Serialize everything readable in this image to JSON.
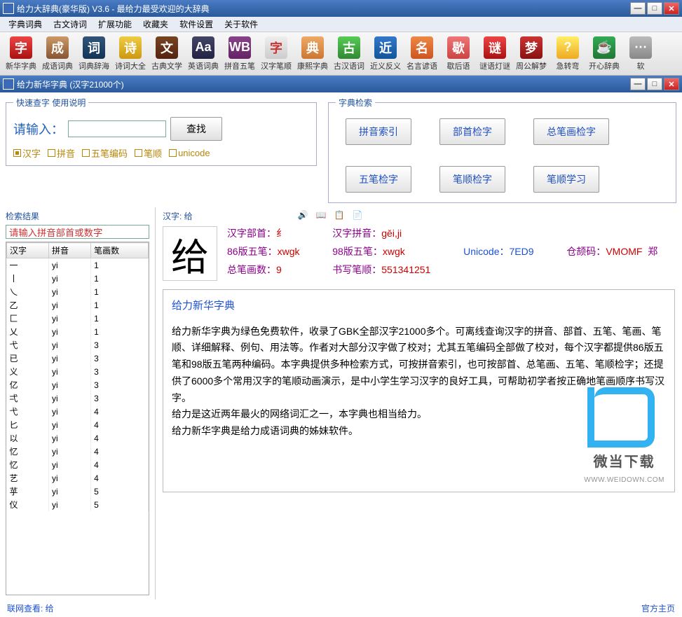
{
  "main_title": "给力大辞典(豪华版) V3.6  -  最给力最受欢迎的大辞典",
  "menus": [
    "字典词典",
    "古文诗词",
    "扩展功能",
    "收藏夹",
    "软件设置",
    "关于软件"
  ],
  "toolbar": [
    {
      "label": "新华字典",
      "glyph": "字"
    },
    {
      "label": "成语词典",
      "glyph": "成"
    },
    {
      "label": "词典辞海",
      "glyph": "词"
    },
    {
      "label": "诗词大全",
      "glyph": "诗"
    },
    {
      "label": "古典文学",
      "glyph": "文"
    },
    {
      "label": "英语词典",
      "glyph": "Aa"
    },
    {
      "label": "拼音五笔",
      "glyph": "WB"
    },
    {
      "label": "汉字笔顺",
      "glyph": "字"
    },
    {
      "label": "康熙字典",
      "glyph": "典"
    },
    {
      "label": "古汉语词",
      "glyph": "古"
    },
    {
      "label": "近义反义",
      "glyph": "近"
    },
    {
      "label": "名言谚语",
      "glyph": "名"
    },
    {
      "label": "歇后语",
      "glyph": "歇"
    },
    {
      "label": "谜语灯谜",
      "glyph": "谜"
    },
    {
      "label": "周公解梦",
      "glyph": "梦"
    },
    {
      "label": "急转弯",
      "glyph": "?"
    },
    {
      "label": "开心辞典",
      "glyph": "☕"
    },
    {
      "label": "软",
      "glyph": "⋯"
    }
  ],
  "sub_title": "给力新华字典    (汉字21000个)",
  "quick": {
    "legend": "快速查字    使用说明",
    "input_label": "请输入：",
    "input_value": "",
    "find_btn": "查找",
    "radios": [
      "汉字",
      "拼音",
      "五笔编码",
      "笔顺",
      "unicode"
    ],
    "selected": 0
  },
  "index": {
    "legend": "字典检索",
    "buttons": [
      "拼音索引",
      "部首检字",
      "总笔画检字",
      "五笔检字",
      "笔顺检字",
      "笔顺学习"
    ]
  },
  "results": {
    "label": "检索结果",
    "filter_placeholder": "请输入拼音部首或数字",
    "cols": [
      "汉字",
      "拼音",
      "笔画数"
    ],
    "rows": [
      [
        "一",
        "yi",
        "1"
      ],
      [
        "丨",
        "yi",
        "1"
      ],
      [
        "乀",
        "yi",
        "1"
      ],
      [
        "乙",
        "yi",
        "1"
      ],
      [
        "匚",
        "yi",
        "1"
      ],
      [
        "乂",
        "yi",
        "1"
      ],
      [
        "弋",
        "yi",
        "3"
      ],
      [
        "已",
        "yi",
        "3"
      ],
      [
        "义",
        "yi",
        "3"
      ],
      [
        "亿",
        "yi",
        "3"
      ],
      [
        "弌",
        "yi",
        "3"
      ],
      [
        "弋",
        "yi",
        "4"
      ],
      [
        "匕",
        "yi",
        "4"
      ],
      [
        "以",
        "yi",
        "4"
      ],
      [
        "忆",
        "yi",
        "4"
      ],
      [
        "忆",
        "yi",
        "4"
      ],
      [
        "艺",
        "yi",
        "4"
      ],
      [
        "苸",
        "yi",
        "5"
      ],
      [
        "仪",
        "yi",
        "5"
      ]
    ]
  },
  "char": {
    "header_label": "汉字: 给",
    "big": "给",
    "fields": {
      "radical_l": "汉字部首：",
      "radical_v": "纟",
      "pinyin_l": "汉字拼音：",
      "pinyin_v": "gěi,ji",
      "wb86_l": "86版五笔：",
      "wb86_v": "xwgk",
      "wb98_l": "98版五笔：",
      "wb98_v": "xwgk",
      "unicode_l": "Unicode：",
      "unicode_v": "7ED9",
      "cangjie_l": "仓颉码：",
      "cangjie_v": "VMOMF",
      "zheng_l": "郑",
      "strokes_l": "总笔画数：",
      "strokes_v": "9",
      "order_l": "书写笔顺：",
      "order_v": "551341251"
    }
  },
  "desc": {
    "title": "给力新华字典",
    "body": "给力新华字典为绿色免费软件，收录了GBK全部汉字21000多个。可离线查询汉字的拼音、部首、五笔、笔画、笔顺、详细解释、例句、用法等。作者对大部分汉字做了校对；尤其五笔编码全部做了校对，每个汉字都提供86版五笔和98版五笔两种编码。本字典提供多种检索方式，可按拼音索引，也可按部首、总笔画、五笔、笔顺检字；还提供了6000多个常用汉字的笔顺动画演示，是中小学生学习汉字的良好工具，可帮助初学者按正确地笔画顺序书写汉字。\n给力是这近两年最火的网络词汇之一，本字典也相当给力。\n给力新华字典是给力成语词典的姊妹软件。"
  },
  "footer": {
    "left": "联网查看: 给",
    "right": "官方主页"
  },
  "watermark": {
    "text": "微当下载",
    "url": "WWW.WEIDOWN.COM"
  }
}
